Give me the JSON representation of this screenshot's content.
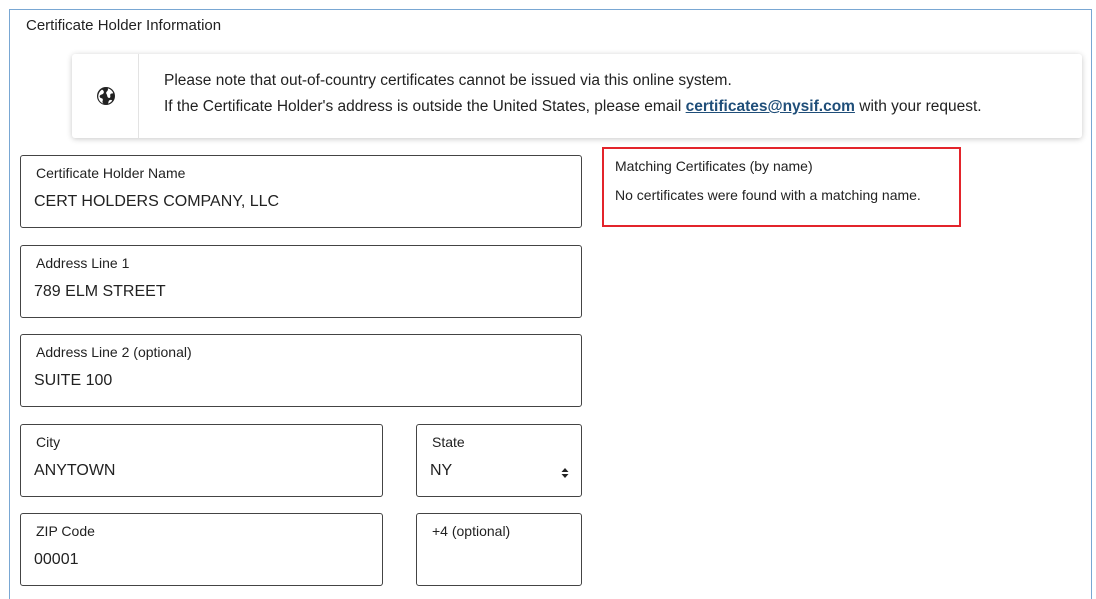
{
  "section": {
    "title": "Certificate Holder Information"
  },
  "notice": {
    "icon": "globe-icon",
    "line1": "Please note that out-of-country certificates cannot be issued via this online system.",
    "line2_prefix": "If the Certificate Holder's address is outside the United States, please email ",
    "email": "certificates@nysif.com",
    "line2_suffix": " with your request."
  },
  "form": {
    "name": {
      "label": "Certificate Holder Name",
      "value": "CERT HOLDERS COMPANY, LLC"
    },
    "address1": {
      "label": "Address Line 1",
      "value": "789 ELM STREET"
    },
    "address2": {
      "label": "Address Line 2 (optional)",
      "value": "SUITE 100"
    },
    "city": {
      "label": "City",
      "value": "ANYTOWN"
    },
    "state": {
      "label": "State",
      "value": "NY"
    },
    "zip": {
      "label": "ZIP Code",
      "value": "00001"
    },
    "plus4": {
      "label": "+4 (optional)",
      "value": ""
    }
  },
  "matching": {
    "title": "Matching Certificates (by name)",
    "message": "No certificates were found with a matching name."
  },
  "colors": {
    "frame_border": "#79a7d3",
    "highlight_border": "#e3242b",
    "link": "#1f4e79"
  }
}
